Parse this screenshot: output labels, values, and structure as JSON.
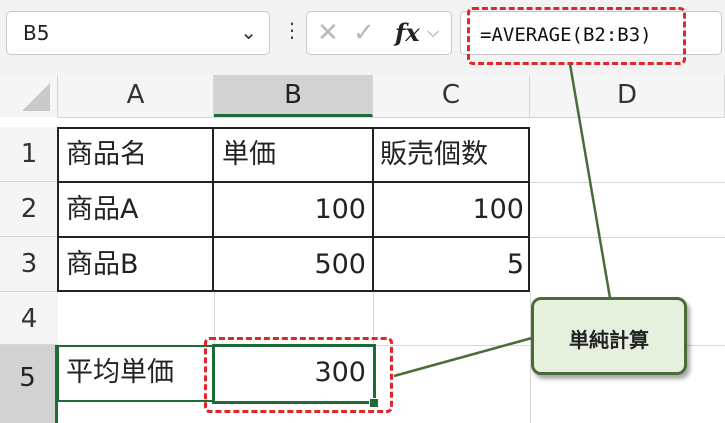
{
  "formula_bar": {
    "name_box": "B5",
    "name_box_chevron": "⌄",
    "more_dots": "⋮",
    "cancel_symbol": "✕",
    "enter_symbol": "✓",
    "fx_label": "fx",
    "fx_chevron": "⌵",
    "formula": "=AVERAGE(B2:B3)"
  },
  "columns": [
    "A",
    "B",
    "C",
    "D"
  ],
  "rows": [
    "1",
    "2",
    "3",
    "4",
    "5"
  ],
  "cells": {
    "A1": "商品名",
    "B1": "単価",
    "C1": "販売個数",
    "A2": "商品A",
    "B2": "100",
    "C2": "100",
    "A3": "商品B",
    "B3": "500",
    "C3": "5",
    "A5": "平均単価",
    "B5": "300"
  },
  "callout": {
    "label": "単純計算"
  },
  "colors": {
    "accent_green": "#1e6b3a",
    "highlight_red": "#e0262a",
    "callout_fill": "#e5f1dd",
    "callout_border": "#4a6b3a"
  },
  "icons": [
    "chevron-down-icon",
    "more-options-icon",
    "cancel-icon",
    "enter-icon",
    "function-icon"
  ]
}
